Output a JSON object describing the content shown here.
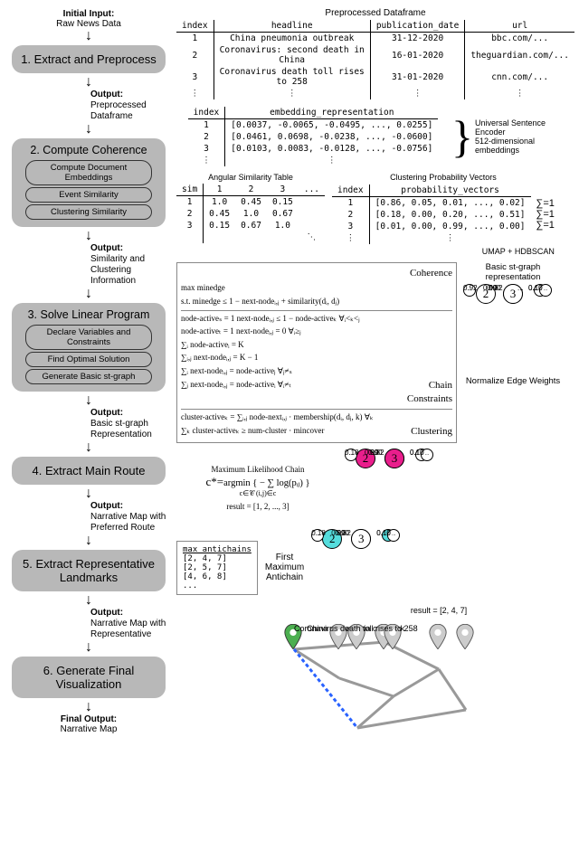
{
  "flow": {
    "initial_label_b": "Initial Input:",
    "initial_label": "Raw News Data",
    "steps": [
      {
        "title": "1. Extract and Preprocess",
        "subs": [],
        "out_b": "Output:",
        "out": "Preprocessed\nDataframe"
      },
      {
        "title": "2. Compute Coherence",
        "subs": [
          "Compute Document\nEmbeddings",
          "Event Similarity",
          "Clustering Similarity"
        ],
        "out_b": "Output:",
        "out": "Similarity and\nClustering\nInformation"
      },
      {
        "title": "3. Solve Linear Program",
        "subs": [
          "Declare Variables\nand Constraints",
          "Find Optimal\nSolution",
          "Generate Basic\nst-graph"
        ],
        "out_b": "Output:",
        "out": "Basic st-graph\nRepresentation"
      },
      {
        "title": "4. Extract Main Route",
        "subs": [],
        "out_b": "Output:",
        "out": "Narrative Map with\nPreferred Route"
      },
      {
        "title": "5. Extract Representative Landmarks",
        "subs": [],
        "out_b": "Output:",
        "out": "Narrative Map with\nRepresentative"
      },
      {
        "title": "6. Generate Final Visualization",
        "subs": [],
        "out_b": "",
        "out": ""
      }
    ],
    "final_label_b": "Final Output:",
    "final_label": "Narrative Map"
  },
  "df_caption": "Preprocessed Dataframe",
  "df": {
    "cols": [
      "index",
      "headline",
      "publication_date",
      "url"
    ],
    "rows": [
      [
        "1",
        "China pneumonia outbreak",
        "31-12-2020",
        "bbc.com/..."
      ],
      [
        "2",
        "Coronavirus: second death in China",
        "16-01-2020",
        "theguardian.com/..."
      ],
      [
        "3",
        "Coronavirus death toll rises to 258",
        "31-01-2020",
        "cnn.com/..."
      ],
      [
        "⋮",
        "⋮",
        "⋮",
        "⋮"
      ]
    ]
  },
  "emb": {
    "cols": [
      "index",
      "embedding_representation"
    ],
    "rows": [
      [
        "1",
        "[0.0037, -0.0065, -0.0495, ..., 0.0255]"
      ],
      [
        "2",
        "[0.0461, 0.0698, -0.0238, ..., -0.0600]"
      ],
      [
        "3",
        "[0.0103, 0.0083, -0.0128, ..., -0.0756]"
      ],
      [
        "⋮",
        "⋮"
      ]
    ],
    "brace_label": "Universal Sentence Encoder\n512-dimensional embeddings"
  },
  "sim": {
    "caption": "Angular Similarity Table",
    "cols": [
      "sim",
      "1",
      "2",
      "3",
      "..."
    ],
    "rows": [
      [
        "1",
        "1.0",
        "0.45",
        "0.15"
      ],
      [
        "2",
        "0.45",
        "1.0",
        "0.67"
      ],
      [
        "3",
        "0.15",
        "0.67",
        "1.0"
      ],
      [
        "",
        "",
        "",
        "",
        "⋱"
      ]
    ]
  },
  "clust": {
    "caption": "Clustering Probability Vectors",
    "cols": [
      "index",
      "probability_vectors"
    ],
    "rows": [
      [
        "1",
        "[0.86, 0.05, 0.01, ..., 0.02]"
      ],
      [
        "2",
        "[0.18, 0.00, 0.20, ..., 0.51]"
      ],
      [
        "3",
        "[0.01, 0.00, 0.99, ..., 0.00]"
      ],
      [
        "⋮",
        "⋮"
      ]
    ],
    "sum": "∑=1",
    "note": "UMAP + HDBSCAN"
  },
  "lp": {
    "coherence": "Coherence",
    "max": "max   minedge",
    "st": "s.t.  minedge ≤ 1 − next-nodeᵢ,ⱼ + similarity(dᵢ, dⱼ)",
    "c1": "node-activeₛ = 1      next-nodeᵢ,ⱼ ≤ 1 − node-activeₖ   ∀ᵢ<ₖ<ⱼ",
    "c2": "node-activeₜ = 1      next-nodeᵢ,ⱼ = 0   ∀ᵢ≥ⱼ",
    "c3": "∑ᵢ node-activeᵢ = K",
    "c4": "∑ᵢ,ⱼ next-nodeᵢ,ⱼ = K − 1",
    "c5": "∑ᵢ next-nodeᵢ,ⱼ = node-activeⱼ   ∀ⱼ≠ₛ",
    "c6": "∑ⱼ next-nodeᵢ,ⱼ = node-activeᵢ   ∀ᵢ≠ₜ",
    "chain": "Chain\nConstraints",
    "cl1": "cluster-activeₖ = ∑ᵢ,ⱼ node-nextᵢ,ⱼ · membership(dᵢ, dⱼ, k)   ∀ₖ",
    "cl2": "∑ₖ cluster-activeₖ ≥ num-cluster · mincover",
    "clustering": "Clustering",
    "graph_caption": "Basic st-graph\nrepresentation",
    "graph_note": "Normalize Edge Weights",
    "edges": {
      "e12": "0.90",
      "e1d": "0.10",
      "e2l": "0.92",
      "e2r": "...",
      "e23": "0.82",
      "e3l": "0.90",
      "e3r": "...",
      "e3b": "0.10"
    }
  },
  "chain": {
    "caption": "Maximum Likelihood Chain",
    "formula_lhs": "c*=",
    "formula": "argmin { − ∑ log(pᵢⱼ) }",
    "formula_sub": "c∈𝒞         (i,j)∈c",
    "result": "result = [1, 2, ..., 3]",
    "edges": {
      "e12": "0.90",
      "e1r": "0.10",
      "e2l": "0.18",
      "e23": "0.82",
      "e3l": "0.90",
      "e3r": "0.10"
    }
  },
  "antichain": {
    "box_title": "max_antichains",
    "rows": [
      "[2, 4, 7]",
      "[2, 5, 7]",
      "[4, 6, 8]",
      "..."
    ],
    "label": "First\nMaximum\nAntichain",
    "result": "result = [2, 4, 7]",
    "edges": {
      "e12": "0.90",
      "e1r": "0.10",
      "e2l": "0.18",
      "e23": "0.82",
      "e3l": "0.90",
      "e3r": "0.10"
    }
  },
  "final": {
    "top_label": "China pneumonia outbreak",
    "bottom_label": "Coronavirus death toll rises to 258"
  }
}
